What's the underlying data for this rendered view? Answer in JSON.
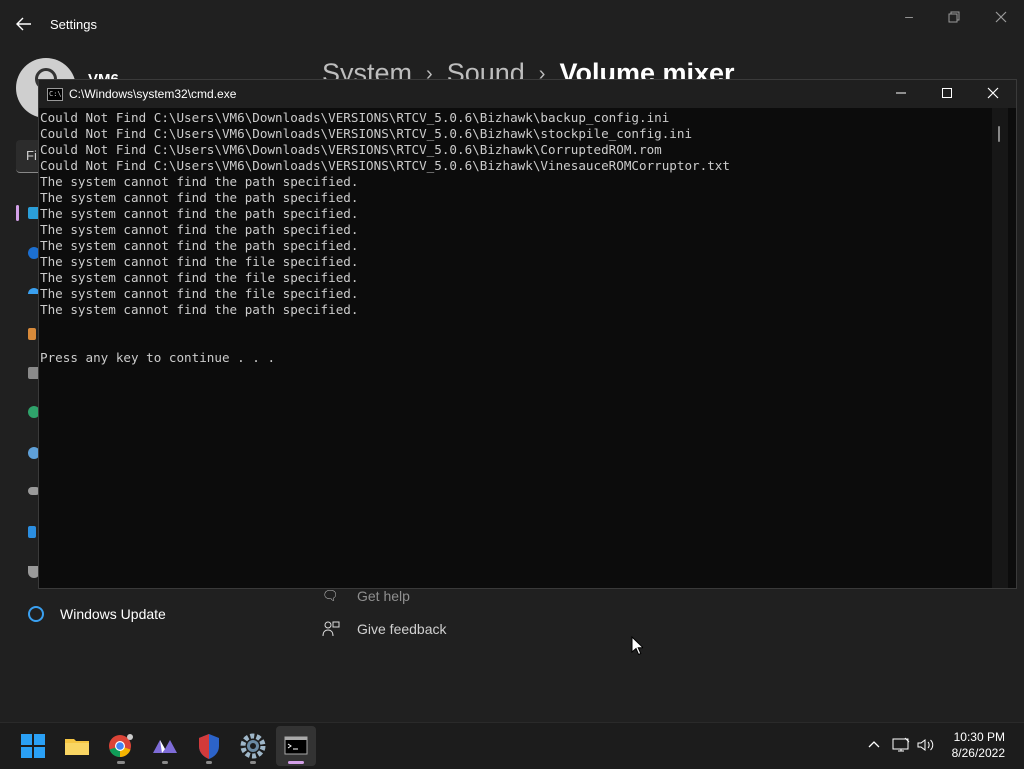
{
  "settings": {
    "app_title": "Settings",
    "profile_name": "VM6",
    "breadcrumb": [
      "System",
      "Sound",
      "Volume mixer"
    ],
    "find_placeholder": "Fi",
    "nav_windows_update": "Windows Update",
    "links": {
      "get_help": "Get help",
      "give_feedback": "Give feedback"
    }
  },
  "cmd": {
    "title": "C:\\Windows\\system32\\cmd.exe",
    "app_icon_text": "C:\\",
    "lines": [
      "Could Not Find C:\\Users\\VM6\\Downloads\\VERSIONS\\RTCV_5.0.6\\Bizhawk\\backup_config.ini",
      "Could Not Find C:\\Users\\VM6\\Downloads\\VERSIONS\\RTCV_5.0.6\\Bizhawk\\stockpile_config.ini",
      "Could Not Find C:\\Users\\VM6\\Downloads\\VERSIONS\\RTCV_5.0.6\\Bizhawk\\CorruptedROM.rom",
      "Could Not Find C:\\Users\\VM6\\Downloads\\VERSIONS\\RTCV_5.0.6\\Bizhawk\\VinesauceROMCorruptor.txt",
      "The system cannot find the path specified.",
      "The system cannot find the path specified.",
      "The system cannot find the path specified.",
      "The system cannot find the path specified.",
      "The system cannot find the path specified.",
      "The system cannot find the file specified.",
      "The system cannot find the file specified.",
      "The system cannot find the file specified.",
      "The system cannot find the path specified.",
      "",
      "",
      "Press any key to continue . . ."
    ]
  },
  "taskbar": {
    "apps": [
      "start",
      "file-explorer",
      "chrome",
      "app-purple",
      "app-shield",
      "settings",
      "terminal"
    ],
    "active_app": "terminal",
    "time": "10:30 PM",
    "date": "8/26/2022"
  },
  "colors": {
    "console_text": "#cccccc",
    "console_bg": "#0c0c0c",
    "accent": "#d3a0e8"
  }
}
